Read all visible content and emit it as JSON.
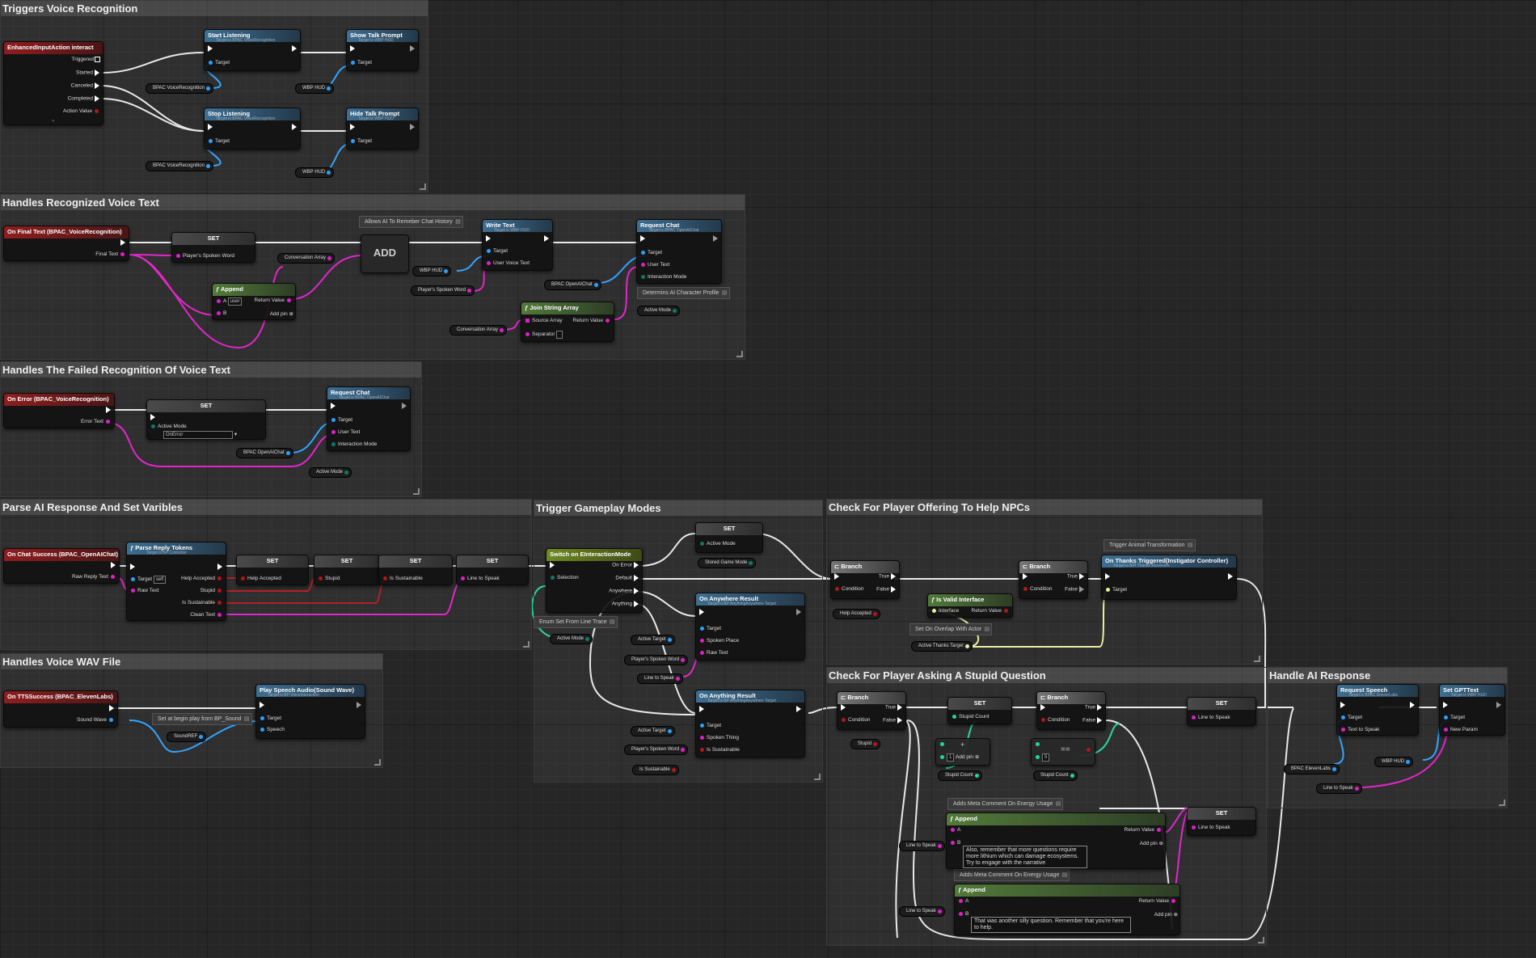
{
  "comments": {
    "c1": "Triggers Voice Recognition",
    "c2": "Handles Recognized Voice Text",
    "c3": "Handles The Failed Recognition Of Voice Text",
    "c4": "Parse AI Response And Set Varibles",
    "c5": "Handles Voice WAV File",
    "c6": "Trigger Gameplay Modes",
    "c7": "Check For Player Offering To Help NPCs",
    "c8": "Check For Player Asking A Stupid Question",
    "c9": "Handle AI Response"
  },
  "nodes": {
    "ia_interact": {
      "title": "EnhancedInputAction interact",
      "pins": [
        "Triggered",
        "Started",
        "Canceled",
        "Completed",
        "Action Value"
      ]
    },
    "start_listening": {
      "title": "Start Listening",
      "sub": "Target is BPAC VoiceRecognition",
      "target": "Target"
    },
    "show_talk": {
      "title": "Show Talk Prompt",
      "sub": "Target is WBP HUD",
      "target": "Target"
    },
    "stop_listening": {
      "title": "Stop Listening",
      "sub": "Target is BPAC VoiceRecognition",
      "target": "Target"
    },
    "hide_talk": {
      "title": "Hide Talk Prompt",
      "sub": "Target is WBP HUD",
      "target": "Target"
    },
    "on_final_text": {
      "title": "On Final Text (BPAC_VoiceRecognition)",
      "pin": "Final Text"
    },
    "set_spoken": {
      "title": "SET",
      "pin": "Player's Spoken Word"
    },
    "append1": {
      "title": "Append",
      "a": "A",
      "a_val": "user",
      "b": "B",
      "ret": "Return Value",
      "add": "Add pin"
    },
    "add": {
      "title": "ADD"
    },
    "write_text": {
      "title": "Write Text",
      "sub": "Target is WBP HUD",
      "target": "Target",
      "user": "User Voice Text"
    },
    "request_chat1": {
      "title": "Request Chat",
      "sub": "Target is BPAC OpenAIChat",
      "target": "Target",
      "user": "User Text",
      "mode": "Interaction Mode"
    },
    "join": {
      "title": "Join String Array",
      "src": "Source Array",
      "sep": "Separator",
      "ret": "Return Value"
    },
    "on_error": {
      "title": "On Error (BPAC_VoiceRecognition)",
      "pin": "Error Text"
    },
    "set_mode": {
      "title": "SET",
      "pin": "Active Mode",
      "val": "OnError"
    },
    "request_chat2": {
      "title": "Request Chat",
      "sub": "Target is BPAC OpenAIChat",
      "target": "Target",
      "user": "User Text",
      "mode": "Interaction Mode"
    },
    "on_chat_success": {
      "title": "On Chat Success (BPAC_OpenAIChat)",
      "pin": "Raw Reply Text"
    },
    "parse_reply": {
      "title": "Parse Reply Tokens",
      "sub": "Target is BP Controller",
      "target": "Target",
      "target_val": "self",
      "raw": "Raw Text",
      "outs": [
        "Help Accepted",
        "Stupid",
        "Is Sustainable",
        "Clean Text"
      ]
    },
    "set_help": {
      "title": "SET",
      "pin": "Help Accepted"
    },
    "set_stupid": {
      "title": "SET",
      "pin": "Stupid"
    },
    "set_sust": {
      "title": "SET",
      "pin": "Is Sustainable"
    },
    "set_line": {
      "title": "SET",
      "pin": "Line to Speak"
    },
    "on_tts": {
      "title": "On TTSSuccess (BPAC_ElevenLabs)",
      "pin": "Sound Wave"
    },
    "play_speech": {
      "title": "Play Speech Audio(Sound Wave)",
      "sub": "Target is BP VoiceInteraction",
      "target": "Target",
      "speech": "Speech"
    },
    "switch_mode": {
      "title": "Switch on EInteractionMode",
      "sel": "Selection",
      "outs": [
        "On Error",
        "Default",
        "Anywhere",
        "Anything"
      ]
    },
    "set_game_mode": {
      "title": "SET",
      "pin": "Active Mode"
    },
    "on_anywhere": {
      "title": "On Anywhere Result",
      "sub": "Target is BP AnythingAnywhere Target",
      "pins": [
        "Target",
        "Spoken Place",
        "Raw Text"
      ]
    },
    "on_anything": {
      "title": "On Anything Result",
      "sub": "Target is BP AnythingAnywhere Target",
      "pins": [
        "Target",
        "Spoken Thing",
        "Is Sustainable"
      ]
    },
    "branch1": {
      "title": "Branch",
      "cond": "Condition",
      "t": "True",
      "f": "False"
    },
    "branch2": {
      "title": "Branch",
      "cond": "Condition",
      "t": "True",
      "f": "False"
    },
    "is_valid": {
      "title": "Is Valid Interface",
      "in": "Interface",
      "ret": "Return Value"
    },
    "on_thanks": {
      "title": "On Thanks Triggered(Instigator Controller)",
      "sub": "Target is BPI Thanks Receivers",
      "target": "Target"
    },
    "branch3": {
      "title": "Branch",
      "cond": "Condition",
      "t": "True",
      "f": "False"
    },
    "set_stupid_count": {
      "title": "SET",
      "pin": "Stupid Count"
    },
    "add_int": {
      "title": "+",
      "add": "Add pin",
      "val": "1"
    },
    "branch4": {
      "title": "Branch",
      "cond": "Condition",
      "t": "True",
      "f": "False"
    },
    "eq": {
      "title": "==",
      "val": "5"
    },
    "append2": {
      "title": "Append",
      "a": "A",
      "b": "B",
      "ret": "Return Value",
      "add": "Add pin",
      "text": "Also, remember that more questions require more lithium which can damage ecosystems. Try to engage with the narrative"
    },
    "append3": {
      "title": "Append",
      "a": "A",
      "b": "B",
      "ret": "Return Value",
      "add": "Add pin",
      "text": "That was another silly question. Remember that you're here to help."
    },
    "set_line2": {
      "title": "SET",
      "pin": "Line to Speak"
    },
    "set_line3": {
      "title": "SET",
      "pin": "Line to Speak"
    },
    "request_speech": {
      "title": "Request Speech",
      "sub": "Target is BPAC ElevenLabs",
      "target": "Target",
      "text": "Text to Speak"
    },
    "set_gpt": {
      "title": "Set GPTText",
      "sub": "Target is WBP HUD",
      "target": "Target",
      "param": "New Param"
    }
  },
  "variables": {
    "v_bpac_voice1": "BPAC VoiceRecognition",
    "v_wbp1": "WBP HUD",
    "v_bpac_voice2": "BPAC VoiceRecognition",
    "v_wbp2": "WBP HUD",
    "v_conv1": "Conversation Array",
    "v_wbp3": "WBP HUD",
    "v_spoken1": "Player's Spoken Word",
    "v_openai1": "BPAC OpenAIChat",
    "v_conv2": "Conversation Array",
    "v_active1": "Active Mode",
    "v_openai2": "BPAC OpenAIChat",
    "v_active2": "Active Mode",
    "v_stored": "Stored Game Mode",
    "v_active3": "Active Mode",
    "v_active_target1": "Active Target",
    "v_spoken2": "Player's Spoken Word",
    "v_line1": "Line to Speak",
    "v_active_target2": "Active Target",
    "v_spoken3": "Player's Spoken Word",
    "v_sust": "Is Sustainable",
    "v_help": "Help Accepted",
    "v_active_thanks": "Active Thanks Target",
    "v_stupid": "Stupid",
    "v_stupid_count1": "Stupid Count",
    "v_stupid_count2": "Stupid Count",
    "v_line2": "Line to Speak",
    "v_line3": "Line to Speak",
    "v_eleven": "BPAC ElevenLabs",
    "v_wbp4": "WBP HUD",
    "v_line4": "Line to Speak",
    "v_sound_ref": "SoundREF"
  },
  "notes": {
    "n_history": "Allows AI To Remeber Chat History",
    "n_profile": "Determins AI Character Profile",
    "n_linetrace": "Enum Set From Line Trace",
    "n_beginplay": "Set at begin play from BP_Sound",
    "n_animal": "Trigger Animal Transformation",
    "n_overlap": "Set On Overlap With Actor",
    "n_meta1": "Adds Meta Comment On Energy Usage",
    "n_meta2": "Adds Meta Comment On Energy Usage"
  },
  "colors": {
    "exec": "#ffffff",
    "object": "#2aa0ff",
    "string": "#e01ec8",
    "bool": "#b0171a",
    "enum": "#0e7a62",
    "int": "#20d7a0",
    "interface": "#e8f0a0"
  }
}
